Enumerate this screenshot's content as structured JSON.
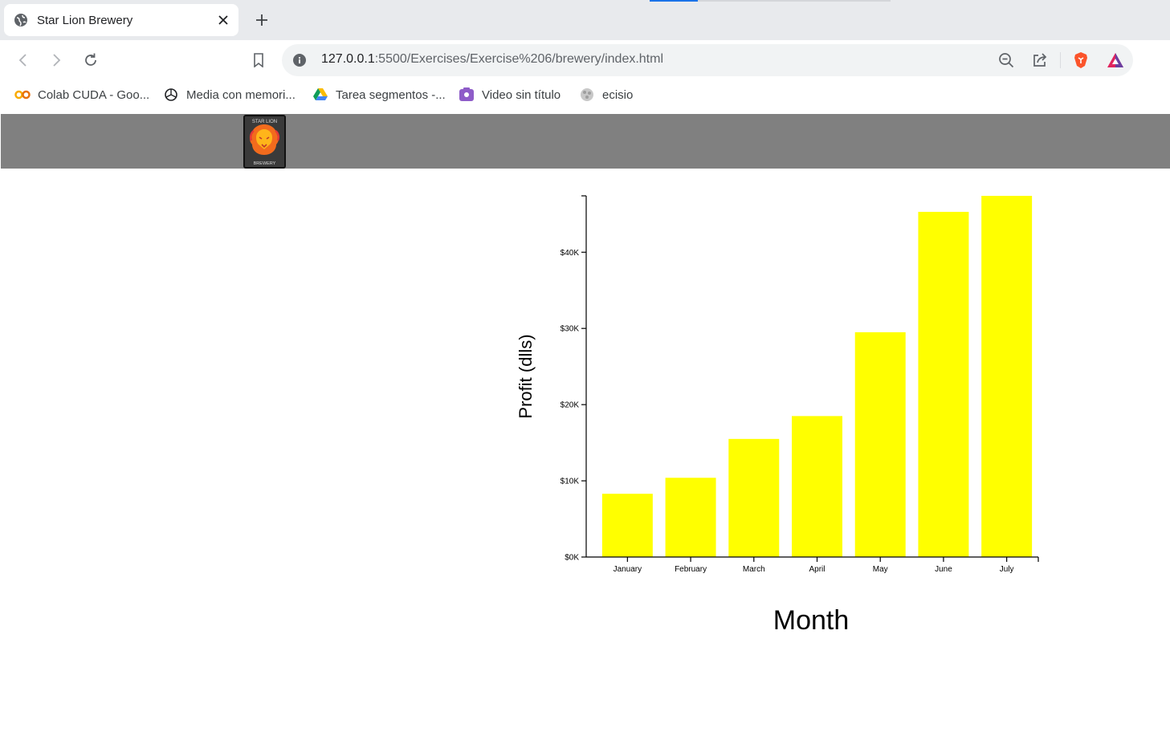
{
  "browser": {
    "tab": {
      "title": "Star Lion Brewery"
    },
    "omnibox": {
      "url_host": "127.0.0.1",
      "url_rest": ":5500/Exercises/Exercise%206/brewery/index.html"
    },
    "bookmarks": [
      {
        "label": "Colab CUDA - Goo...",
        "icon": "colab-icon"
      },
      {
        "label": "Media con memori...",
        "icon": "openai-icon"
      },
      {
        "label": "Tarea segmentos -...",
        "icon": "google-drive-icon"
      },
      {
        "label": "Video sin título",
        "icon": "video-icon"
      },
      {
        "label": "ecisio",
        "icon": "globe-icon"
      }
    ],
    "colors": {
      "tabstrip": "#e8eaed",
      "omnibox": "#f1f3f4",
      "brave": "#fb542b"
    }
  },
  "page": {
    "navbar_color": "#808080",
    "logo": {
      "text_top": "STAR LION",
      "text_bottom": "BREWERY"
    }
  },
  "chart_data": {
    "type": "bar",
    "categories": [
      "January",
      "February",
      "March",
      "April",
      "May",
      "June",
      "July"
    ],
    "values": [
      8300,
      10400,
      15500,
      18500,
      29500,
      45300,
      47400
    ],
    "xlabel": "Month",
    "ylabel": "Profit (dlls)",
    "ylim": [
      0,
      47400
    ],
    "yticks": [
      0,
      10000,
      20000,
      30000,
      40000
    ],
    "ytick_labels": [
      "$0K",
      "$10K",
      "$20K",
      "$30K",
      "$40K"
    ],
    "bar_color": "#ffff00",
    "grid": false
  }
}
